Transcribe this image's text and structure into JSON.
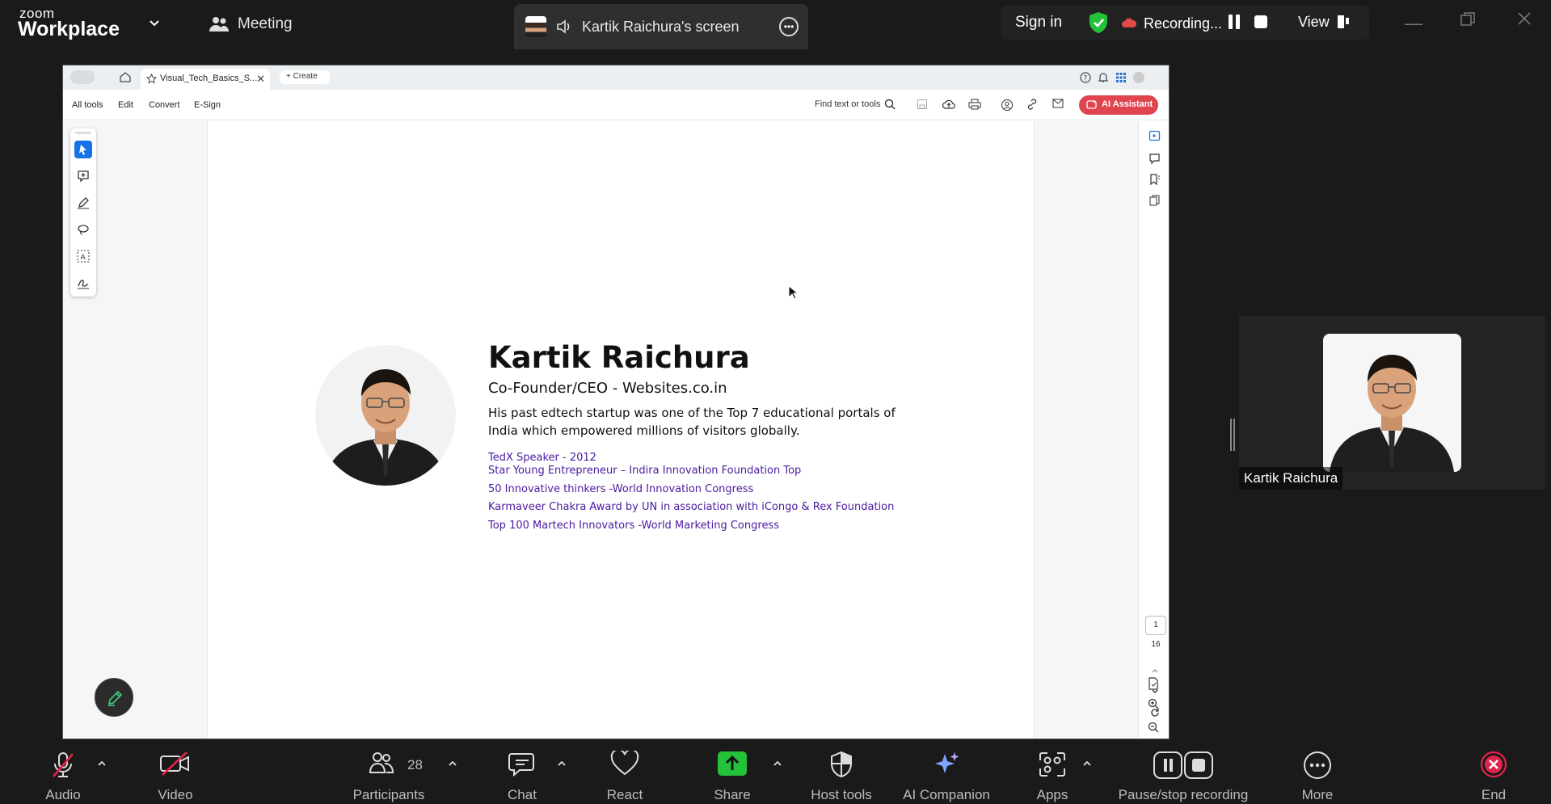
{
  "app": {
    "brand_top": "zoom",
    "brand_bottom": "Workplace",
    "meeting_label": "Meeting"
  },
  "share": {
    "title": "Kartik Raichura's screen"
  },
  "topright": {
    "signin": "Sign in",
    "recording": "Recording...",
    "view": "View"
  },
  "acrobat": {
    "tab_title": "Visual_Tech_Basics_S...",
    "create": "Create",
    "menu": [
      "All tools",
      "Edit",
      "Convert",
      "E-Sign"
    ],
    "find": "Find text or tools",
    "ai_button": "AI Assistant",
    "page_current": "1",
    "page_total": "16"
  },
  "slide": {
    "name": "Kartik Raichura",
    "role": "Co-Founder/CEO - Websites.co.in",
    "bio": "His past edtech startup was one of the Top 7 educational portals of India which empowered millions of visitors globally.",
    "achievements": [
      "TedX Speaker - 2012",
      "Star Young Entrepreneur – Indira Innovation Foundation  Top",
      "50 Innovative thinkers -World Innovation Congress",
      "Karmaveer Chakra Award by UN in association with iCongo & Rex Foundation",
      "Top 100 Martech Innovators -World Marketing Congress"
    ]
  },
  "self_video": {
    "name": "Kartik Raichura"
  },
  "toolbar": {
    "audio": "Audio",
    "video": "Video",
    "participants": "Participants",
    "participants_count": "28",
    "chat": "Chat",
    "react": "React",
    "share": "Share",
    "host_tools": "Host tools",
    "ai_companion": "AI Companion",
    "apps": "Apps",
    "pause_stop": "Pause/stop recording",
    "more": "More",
    "end": "End"
  },
  "colors": {
    "share_green": "#24c13a",
    "end_red": "#e0244a",
    "achievement_purple": "#4b1aa0",
    "ai_button": "#e0454f"
  }
}
